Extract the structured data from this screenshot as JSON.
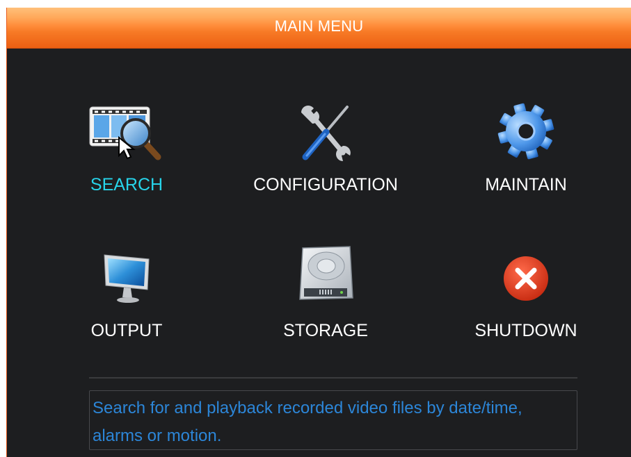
{
  "window": {
    "title": "MAIN MENU"
  },
  "menu": {
    "items": [
      {
        "label": "SEARCH",
        "icon": "film-search-icon",
        "selected": true
      },
      {
        "label": "CONFIGURATION",
        "icon": "tools-icon",
        "selected": false
      },
      {
        "label": "MAINTAIN",
        "icon": "gear-icon",
        "selected": false
      },
      {
        "label": "OUTPUT",
        "icon": "monitor-icon",
        "selected": false
      },
      {
        "label": "STORAGE",
        "icon": "hard-drive-icon",
        "selected": false
      },
      {
        "label": "SHUTDOWN",
        "icon": "shutdown-icon",
        "selected": false
      }
    ]
  },
  "help": {
    "text": "Search for and playback recorded video files by date/time, alarms or motion."
  },
  "colors": {
    "title_bar": "#f77a26",
    "background": "#1d1e20",
    "selected_label": "#27d4ea",
    "help_text": "#2c86d8"
  }
}
